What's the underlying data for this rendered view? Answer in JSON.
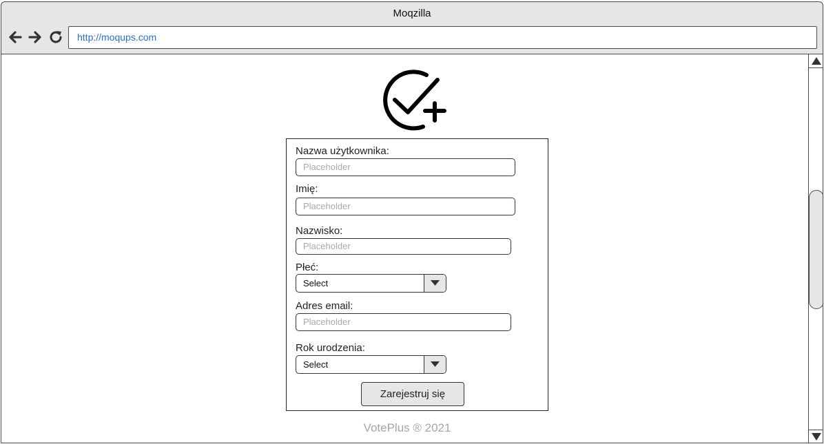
{
  "browser": {
    "title": "Moqzilla",
    "url": "http://moqups.com",
    "nav_icons": [
      "back-arrow-icon",
      "forward-arrow-icon",
      "reload-icon"
    ]
  },
  "logo": {
    "icon": "check-circle-plus-icon"
  },
  "form": {
    "username": {
      "label": "Nazwa użytkownika:",
      "placeholder": "Placeholder"
    },
    "first_name": {
      "label": "Imię:",
      "placeholder": "Placeholder"
    },
    "last_name": {
      "label": "Nazwisko:",
      "placeholder": "Placeholder"
    },
    "gender": {
      "label": "Płeć:",
      "value": "Select"
    },
    "email": {
      "label": "Adres email:",
      "placeholder": "Placeholder"
    },
    "birth_year": {
      "label": "Rok urodzenia:",
      "value": "Select"
    },
    "submit_label": "Zarejestruj się"
  },
  "footer": {
    "text": "VotePlus ® 2021"
  },
  "colors": {
    "chrome": "#e6e6e6",
    "link": "#2b6fce",
    "border": "#4a4a4a",
    "footer_text": "#a6a6a6"
  }
}
